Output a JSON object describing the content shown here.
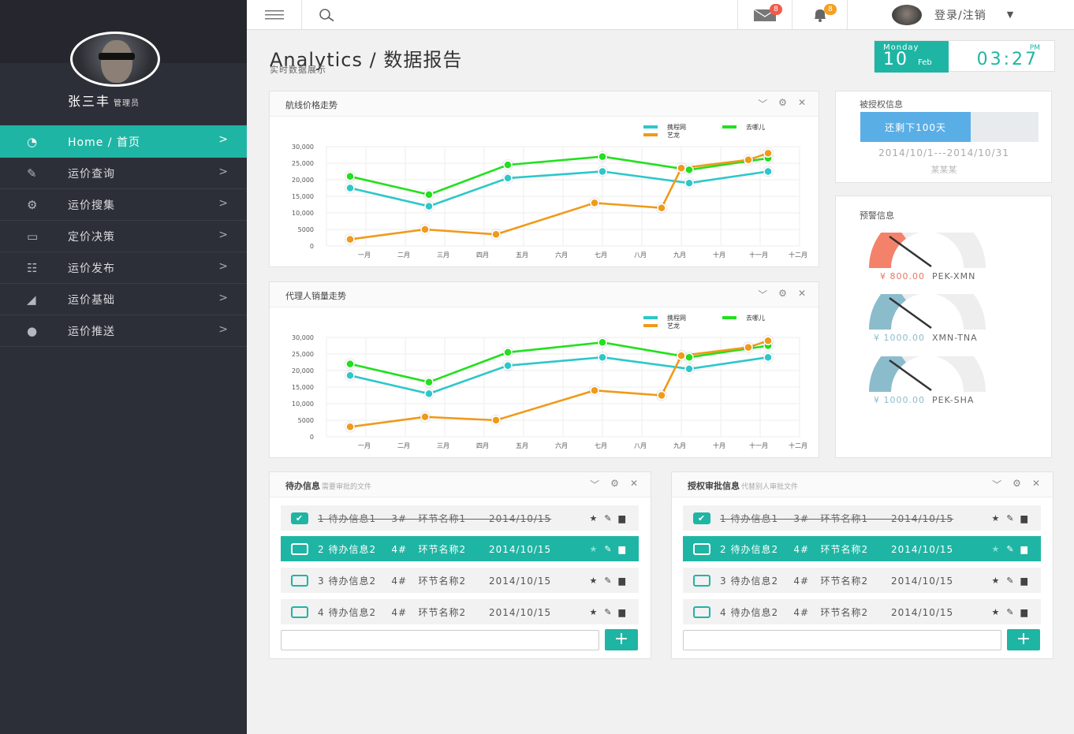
{
  "user": {
    "name": "张三丰",
    "role": "管理员"
  },
  "nav": [
    {
      "label": "Home / 首页",
      "icon": "dashboard-icon",
      "glyph": "◔",
      "active": true
    },
    {
      "label": "运价查询",
      "icon": "pencil-icon",
      "glyph": "✎"
    },
    {
      "label": "运价搜集",
      "icon": "gear-icon",
      "glyph": "⚙"
    },
    {
      "label": "定价决策",
      "icon": "monitor-icon",
      "glyph": "▭"
    },
    {
      "label": "运价发布",
      "icon": "list-icon",
      "glyph": "☷"
    },
    {
      "label": "运价基础",
      "icon": "area-chart-icon",
      "glyph": "◢"
    },
    {
      "label": "运价推送",
      "icon": "location-pin-icon",
      "glyph": "●"
    }
  ],
  "topbar": {
    "mail_count": "8",
    "alert_count": "8",
    "login_label": "登录/注销"
  },
  "page": {
    "title": "Analytics / 数据报告",
    "subtitle": "实时数据展示"
  },
  "clock": {
    "weekday": "Monday",
    "day": "10",
    "month": "Feb",
    "ampm": "PM",
    "time": "03:27"
  },
  "charts_meta": {
    "line1": {
      "title": "航线价格走势"
    },
    "line2": {
      "title": "代理人销量走势"
    }
  },
  "chart_data": [
    {
      "type": "line",
      "title": "航线价格走势",
      "categories": [
        "一月",
        "二月",
        "三月",
        "四月",
        "五月",
        "六月",
        "七月",
        "八月",
        "九月",
        "十月",
        "十一月",
        "十二月"
      ],
      "yticks": [
        "30,000",
        "25,000",
        "20,000",
        "15,000",
        "10,000",
        "5000",
        "0"
      ],
      "ylim": [
        0,
        30000
      ],
      "grid": true,
      "legend": "top-right",
      "series": [
        {
          "name": "携程网",
          "color": "#2ec7c9",
          "points": [
            [
              0.6,
              17500
            ],
            [
              2.6,
              12000
            ],
            [
              4.6,
              20500
            ],
            [
              7.0,
              22500
            ],
            [
              9.2,
              19000
            ],
            [
              11.2,
              22500
            ]
          ]
        },
        {
          "name": "去哪儿",
          "color": "#22e01e",
          "points": [
            [
              0.6,
              21000
            ],
            [
              2.6,
              15500
            ],
            [
              4.6,
              24500
            ],
            [
              7.0,
              27000
            ],
            [
              9.2,
              23000
            ],
            [
              11.2,
              26500
            ]
          ]
        },
        {
          "name": "艺龙",
          "color": "#f09a1a",
          "points": [
            [
              0.6,
              2000
            ],
            [
              2.5,
              5000
            ],
            [
              4.3,
              3500
            ],
            [
              6.8,
              13000
            ],
            [
              8.5,
              11500
            ],
            [
              9.0,
              23500
            ],
            [
              10.7,
              26000
            ],
            [
              11.2,
              28000
            ]
          ]
        }
      ]
    },
    {
      "type": "line",
      "title": "代理人销量走势",
      "categories": [
        "一月",
        "二月",
        "三月",
        "四月",
        "五月",
        "六月",
        "七月",
        "八月",
        "九月",
        "十月",
        "十一月",
        "十二月"
      ],
      "yticks": [
        "30,000",
        "25,000",
        "20,000",
        "15,000",
        "10,000",
        "5000",
        "0"
      ],
      "ylim": [
        0,
        30000
      ],
      "grid": true,
      "legend": "top-right",
      "series": [
        {
          "name": "携程网",
          "color": "#2ec7c9",
          "points": [
            [
              0.6,
              18500
            ],
            [
              2.6,
              13000
            ],
            [
              4.6,
              21500
            ],
            [
              7.0,
              24000
            ],
            [
              9.2,
              20500
            ],
            [
              11.2,
              24000
            ]
          ]
        },
        {
          "name": "去哪儿",
          "color": "#22e01e",
          "points": [
            [
              0.6,
              22000
            ],
            [
              2.6,
              16500
            ],
            [
              4.6,
              25500
            ],
            [
              7.0,
              28500
            ],
            [
              9.2,
              24000
            ],
            [
              11.2,
              27500
            ]
          ]
        },
        {
          "name": "艺龙",
          "color": "#f09a1a",
          "points": [
            [
              0.6,
              3000
            ],
            [
              2.5,
              6000
            ],
            [
              4.3,
              5000
            ],
            [
              6.8,
              14000
            ],
            [
              8.5,
              12500
            ],
            [
              9.0,
              24500
            ],
            [
              10.7,
              27000
            ],
            [
              11.2,
              29000
            ]
          ]
        }
      ]
    }
  ],
  "auth": {
    "title": "被授权信息",
    "progress_label": "还剩下100天",
    "progress_fraction": 0.62,
    "range": "2014/10/1---2014/10/31",
    "name": "某某某"
  },
  "warn": {
    "title": "预警信息",
    "gauges": [
      {
        "amount": "¥ 800.00",
        "route": "PEK-XMN",
        "color": "#f4826b",
        "value_fraction": 0.3
      },
      {
        "amount": "¥ 1000.00",
        "route": "XMN-TNA",
        "color": "#8bbccc",
        "value_fraction": 0.3
      },
      {
        "amount": "¥ 1000.00",
        "route": "PEK-SHA",
        "color": "#8bbccc",
        "value_fraction": 0.3
      }
    ]
  },
  "todo": {
    "title": "待办信息",
    "hint": "需要审批的文件",
    "rows": [
      {
        "text": "1 待办信息1    3#   环节名称1      2014/10/15",
        "checked": true,
        "done": true,
        "selected": false
      },
      {
        "text": "2 待办信息2    4#   环节名称2      2014/10/15",
        "checked": false,
        "done": false,
        "selected": true
      },
      {
        "text": "3 待办信息2    4#   环节名称2      2014/10/15",
        "checked": false,
        "done": false,
        "selected": false
      },
      {
        "text": "4 待办信息2    4#   环节名称2      2014/10/15",
        "checked": false,
        "done": false,
        "selected": false
      }
    ],
    "add_label": "+"
  },
  "approve": {
    "title": "授权审批信息",
    "hint": "代替别人审批文件",
    "rows": [
      {
        "text": "1 待办信息1    3#   环节名称1      2014/10/15",
        "checked": true,
        "done": true,
        "selected": false
      },
      {
        "text": "2 待办信息2    4#   环节名称2      2014/10/15",
        "checked": false,
        "done": false,
        "selected": true
      },
      {
        "text": "3 待办信息2    4#   环节名称2      2014/10/15",
        "checked": false,
        "done": false,
        "selected": false
      },
      {
        "text": "4 待办信息2    4#   环节名称2      2014/10/15",
        "checked": false,
        "done": false,
        "selected": false
      }
    ],
    "add_label": "+"
  }
}
